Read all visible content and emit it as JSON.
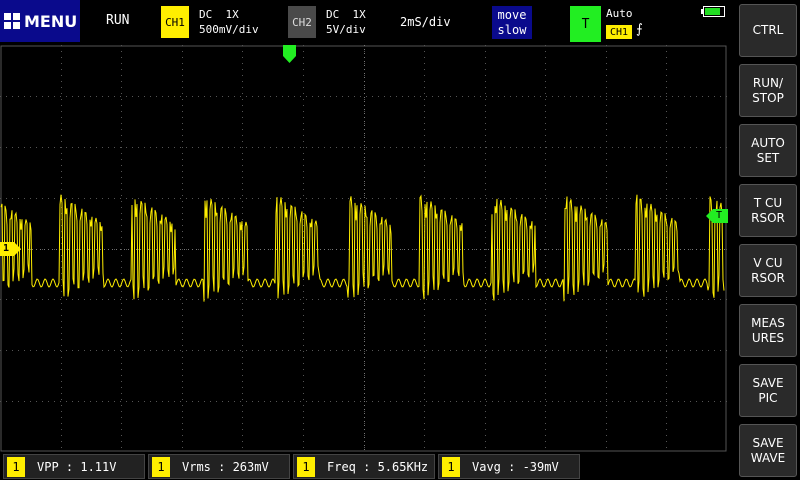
{
  "topbar": {
    "menu_label": "MENU",
    "run_state": "RUN",
    "ch1": {
      "tag": "CH1",
      "coupling": "DC  1X",
      "scale": "500mV/div"
    },
    "ch2": {
      "tag": "CH2",
      "coupling": "DC  1X",
      "scale": "5V/div"
    },
    "timebase": "2mS/div",
    "move": {
      "line1": "move",
      "line2": "slow"
    },
    "trigger": {
      "tag": "T",
      "mode": "Auto",
      "source": "CH1",
      "edge": "⨍"
    },
    "battery_level": 0.85
  },
  "screen": {
    "ch1_marker": "1",
    "trigger_level_marker": "T",
    "colors": {
      "ch1": "#ffee00",
      "trigger": "#22ee22",
      "grid": "#555555"
    }
  },
  "sidebar": {
    "buttons": [
      "CTRL",
      "RUN/\nSTOP",
      "AUTO\nSET",
      "T CU\nRSOR",
      "V CU\nRSOR",
      "MEAS\nURES",
      "SAVE\nPIC",
      "SAVE\nWAVE"
    ]
  },
  "measurements": [
    {
      "num": "1",
      "text": "VPP : 1.11V"
    },
    {
      "num": "1",
      "text": "Vrms : 263mV"
    },
    {
      "num": "1",
      "text": "Freq : 5.65KHz"
    },
    {
      "num": "1",
      "text": "Vavg : -39mV"
    }
  ]
}
